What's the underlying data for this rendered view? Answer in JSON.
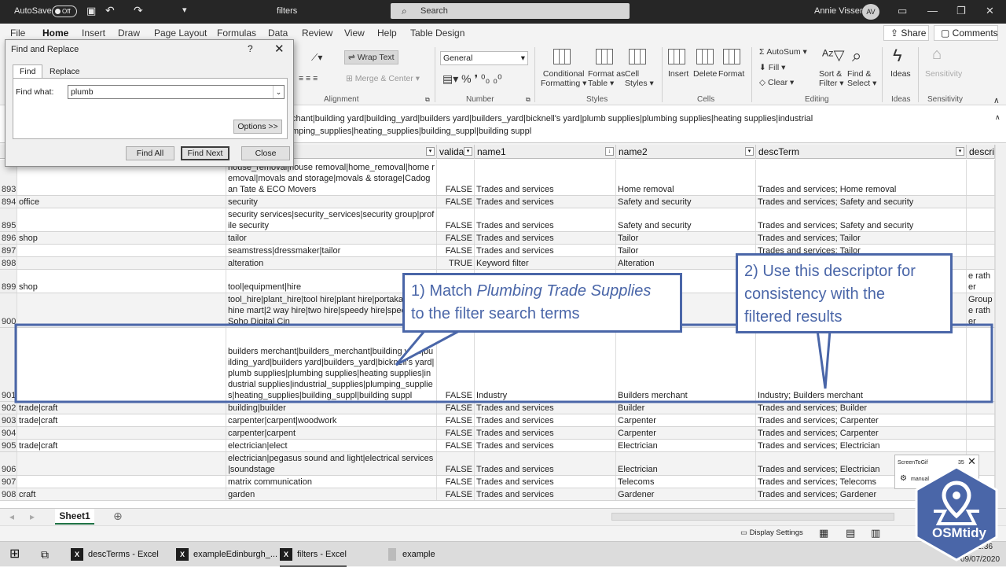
{
  "titlebar": {
    "autosave": "AutoSave",
    "autosave_state": "Off",
    "filename": "filters",
    "search_placeholder": "Search",
    "user_name": "Annie Visser",
    "user_initials": "AV"
  },
  "ribbon_tabs": [
    "File",
    "Home",
    "Insert",
    "Draw",
    "Page Layout",
    "Formulas",
    "Data",
    "Review",
    "View",
    "Help",
    "Table Design"
  ],
  "share_label": "Share",
  "comments_label": "Comments",
  "ribbon": {
    "wrap_text": "Wrap Text",
    "merge_center": "Merge & Center",
    "alignment": "Alignment",
    "number_format": "General",
    "number": "Number",
    "conditional": [
      "Conditional",
      "Formatting"
    ],
    "format_table": [
      "Format as",
      "Table"
    ],
    "cell_styles": [
      "Cell",
      "Styles"
    ],
    "styles": "Styles",
    "insert": "Insert",
    "delete": "Delete",
    "format": "Format",
    "cells": "Cells",
    "autosum": "AutoSum",
    "fill": "Fill",
    "clear": "Clear",
    "sort_filter": [
      "Sort &",
      "Filter"
    ],
    "find_select": [
      "Find &",
      "Select"
    ],
    "editing": "Editing",
    "ideas": "Ideas",
    "ideas_group": "Ideas",
    "sensitivity": "Sensitivity",
    "sensitivity_group": "Sensitivity"
  },
  "formula_bar": {
    "line1": "chant|building yard|building_yard|builders yard|builders_yard|bicknell's yard|plumb supplies|plumbing supplies|heating supplies|industrial",
    "line2": "mping_supplies|heating_supplies|building_suppl|building suppl"
  },
  "columns": [
    "valida",
    "name1",
    "name2",
    "descTerm",
    "descri"
  ],
  "rows": [
    {
      "n": "893",
      "a": "",
      "b": "house_removal|house removal|home_removal|home removal|movals and storage|movals & storage|Cadogan Tate & ECO Movers",
      "v": "FALSE",
      "n1": "Trades and services",
      "n2": "Home removal",
      "d": "Trades and services; Home removal",
      "e": ""
    },
    {
      "n": "894",
      "a": "office",
      "b": "security",
      "v": "FALSE",
      "n1": "Trades and services",
      "n2": "Safety and security",
      "d": "Trades and services; Safety and security",
      "e": ""
    },
    {
      "n": "895",
      "a": "",
      "b": "security services|security_services|security group|profile security",
      "v": "FALSE",
      "n1": "Trades and services",
      "n2": "Safety and security",
      "d": "Trades and services; Safety and security",
      "e": ""
    },
    {
      "n": "896",
      "a": "shop",
      "b": "tailor",
      "v": "FALSE",
      "n1": "Trades and services",
      "n2": "Tailor",
      "d": "Trades and services; Tailor",
      "e": ""
    },
    {
      "n": "897",
      "a": "",
      "b": "seamstress|dressmaker|tailor",
      "v": "FALSE",
      "n1": "Trades and services",
      "n2": "Tailor",
      "d": "Trades and services; Tailor",
      "e": ""
    },
    {
      "n": "898",
      "a": "",
      "b": "alteration",
      "v": "TRUE",
      "n1": "Keyword filter",
      "n2": "Alteration",
      "d": "",
      "e": ""
    },
    {
      "n": "899",
      "a": "shop",
      "b": "tool|equipment|hire",
      "v": "",
      "n1": "",
      "n2": "ent hire",
      "d": "",
      "e": "Groupe rather"
    },
    {
      "n": "900",
      "a": "",
      "b": "tool_hire|plant_hire|tool hire|plant hire|portakabin|machine mart|2 way hire|two hire|speedy hire|speedyhire|Soho Digital Cin",
      "v": "",
      "n1": "",
      "n2": "ent hire",
      "d": "",
      "e": "Groupe rather"
    },
    {
      "n": "901",
      "a": "",
      "b": "builders merchant|builders_merchant|building yard|building_yard|builders yard|builders_yard|bicknell's yard|plumb supplies|plumbing supplies|heating supplies|industrial supplies|industrial_supplies|plumping_supplies|heating_supplies|building_suppl|building suppl",
      "v": "FALSE",
      "n1": "Industry",
      "n2": "Builders merchant",
      "d": "Industry; Builders merchant",
      "e": ""
    },
    {
      "n": "902",
      "a": "trade|craft",
      "b": "building|builder",
      "v": "FALSE",
      "n1": "Trades and services",
      "n2": "Builder",
      "d": "Trades and services; Builder",
      "e": ""
    },
    {
      "n": "903",
      "a": "trade|craft",
      "b": "carpenter|carpent|woodwork",
      "v": "FALSE",
      "n1": "Trades and services",
      "n2": "Carpenter",
      "d": "Trades and services; Carpenter",
      "e": ""
    },
    {
      "n": "904",
      "a": "",
      "b": "carpenter|carpent",
      "v": "FALSE",
      "n1": "Trades and services",
      "n2": "Carpenter",
      "d": "Trades and services; Carpenter",
      "e": ""
    },
    {
      "n": "905",
      "a": "trade|craft",
      "b": "electrician|elect",
      "v": "FALSE",
      "n1": "Trades and services",
      "n2": "Electrician",
      "d": "Trades and services; Electrician",
      "e": ""
    },
    {
      "n": "906",
      "a": "",
      "b": "electrician|pegasus sound and light|electrical services|soundstage",
      "v": "FALSE",
      "n1": "Trades and services",
      "n2": "Electrician",
      "d": "Trades and services; Electrician",
      "e": ""
    },
    {
      "n": "907",
      "a": "",
      "b": "matrix communication",
      "v": "FALSE",
      "n1": "Trades and services",
      "n2": "Telecoms",
      "d": "Trades and services; Telecoms",
      "e": ""
    },
    {
      "n": "908",
      "a": "craft",
      "b": "garden",
      "v": "FALSE",
      "n1": "Trades and services",
      "n2": "Gardener",
      "d": "Trades and services; Gardener",
      "e": ""
    }
  ],
  "sheet_tab": "Sheet1",
  "status": {
    "display_settings": "Display Settings"
  },
  "dialog": {
    "title": "Find and Replace",
    "help": "?",
    "tab_find": "Find",
    "tab_replace": "Replace",
    "find_what_label": "Find what:",
    "find_what_value": "plumb",
    "options": "Options >>",
    "find_all": "Find All",
    "find_next": "Find Next",
    "close": "Close"
  },
  "callouts": {
    "c1_a": "1) Match ",
    "c1_em": "Plumbing Trade Supplies",
    "c1_b": "to the filter search terms",
    "c2_a": "2) Use this descriptor for",
    "c2_b": "consistency with the",
    "c2_c": "filtered results"
  },
  "taskbar": {
    "items": [
      "descTerms - Excel",
      "exampleEdinburgh_...",
      "filters - Excel",
      "example"
    ],
    "time": "12:36",
    "date": "09/07/2020"
  },
  "screentogif": {
    "title": "ScreenToGif",
    "count": "35",
    "label": "manual"
  },
  "logo_text": "OSMtidy",
  "colors": {
    "accent": "#4a66a8",
    "excel_green": "#217346"
  }
}
